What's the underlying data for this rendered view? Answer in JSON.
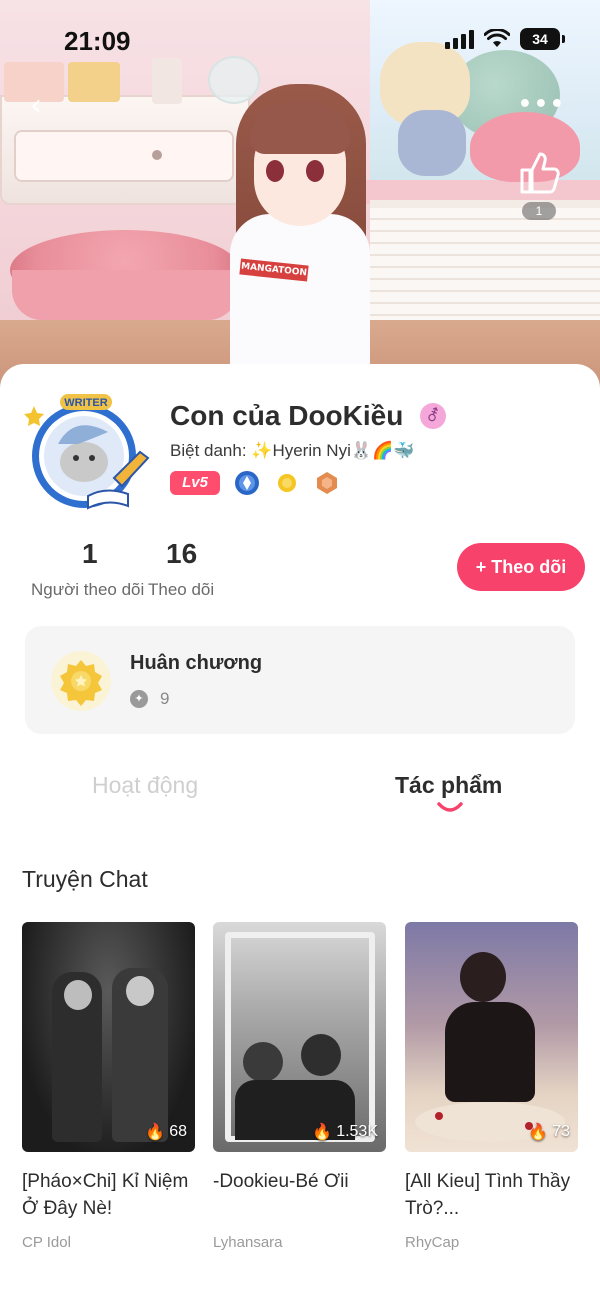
{
  "status_bar": {
    "time": "21:09",
    "battery": "34"
  },
  "hero": {
    "shirt_logo": "MANGATOON",
    "like_count": "1"
  },
  "profile": {
    "avatar_badge": "WRITER",
    "name": "Con của DooKiều",
    "gender_symbol": "⚦",
    "nickname": "Biệt danh: ✨Hyerin Nyi🐰🌈🐳",
    "level": "Lv5"
  },
  "stats": [
    {
      "value": "1",
      "label": "Người theo dõi"
    },
    {
      "value": "16",
      "label": "Theo dõi"
    }
  ],
  "follow_button": "+ Theo dõi",
  "medal": {
    "title": "Huân chương",
    "count": "9"
  },
  "tabs": [
    {
      "label": "Hoạt động",
      "active": false
    },
    {
      "label": "Tác phẩm",
      "active": true
    }
  ],
  "section_title": "Truyện Chat",
  "works": [
    {
      "title": "[Pháo×Chi] Kỉ Niệm Ở Đây Nè!",
      "author": "CP Idol",
      "views": "68"
    },
    {
      "title": "-Dookieu-Bé Ơii",
      "author": "Lyhansara",
      "views": "1.53K"
    },
    {
      "title": "[All Kieu] Tình Thầy Trò?...",
      "author": "RhyCap",
      "views": "73"
    }
  ],
  "colors": {
    "accent": "#f7436c",
    "level_badge": "#ff4d6d"
  }
}
